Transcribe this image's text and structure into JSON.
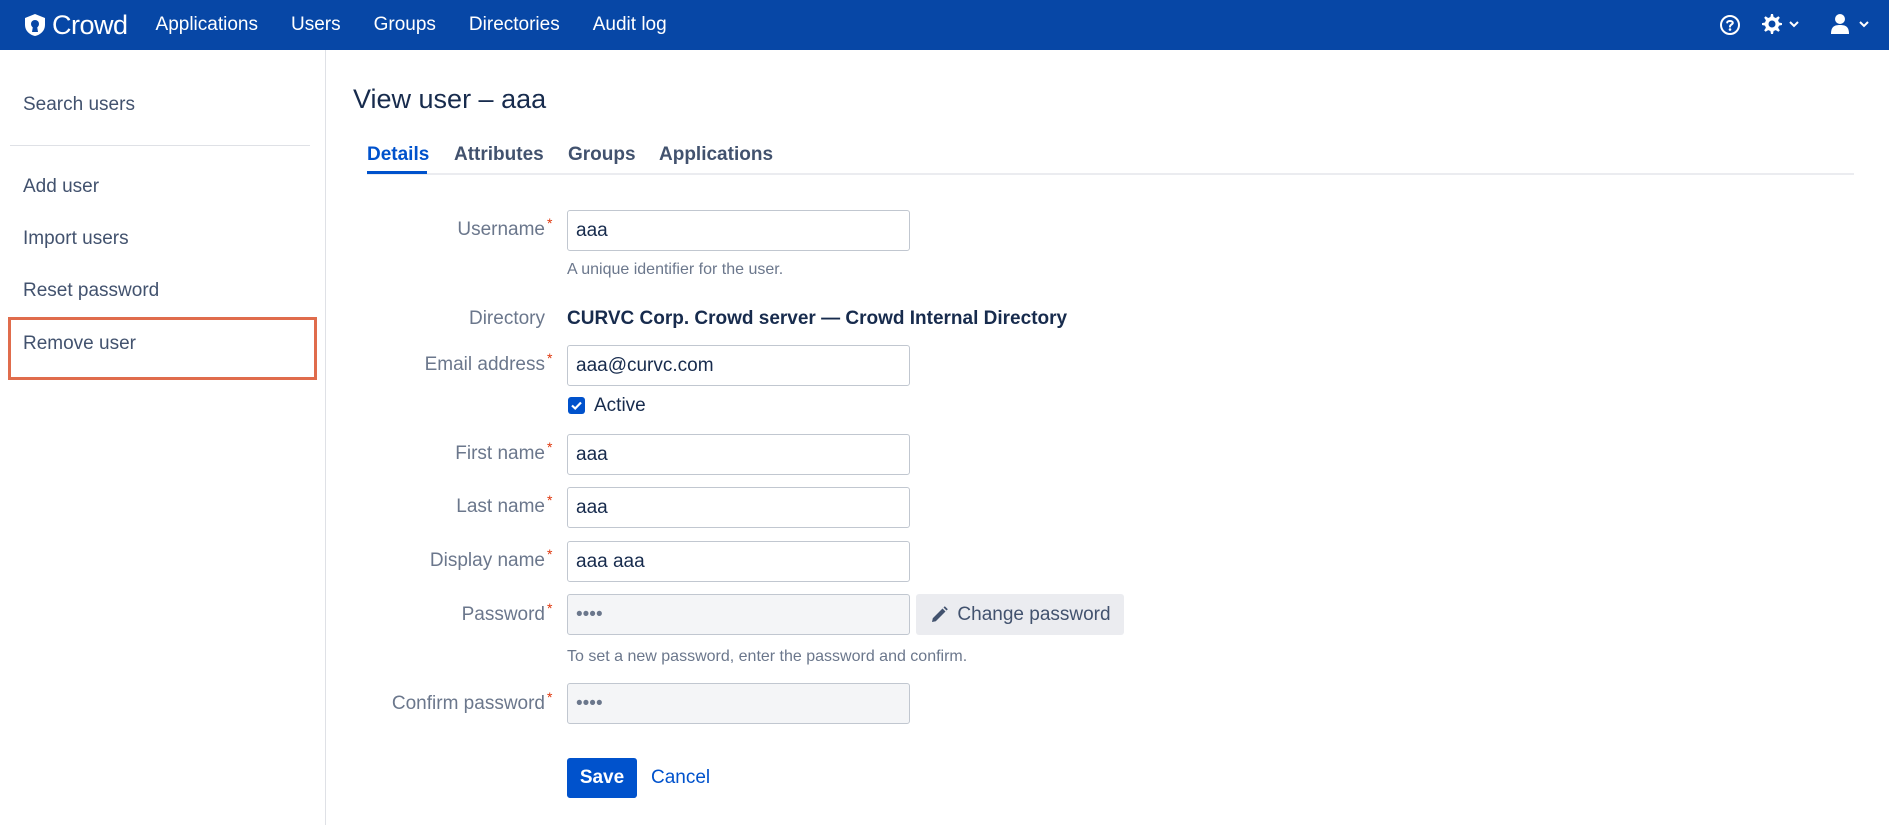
{
  "app": {
    "name": "Crowd"
  },
  "nav": {
    "items": [
      "Applications",
      "Users",
      "Groups",
      "Directories",
      "Audit log"
    ]
  },
  "topbar_icons": [
    "help-icon",
    "gear-icon",
    "user-icon"
  ],
  "sidebar": {
    "search": "Search users",
    "items": [
      "Add user",
      "Import users",
      "Reset password",
      "Remove user"
    ],
    "highlighted": "Remove user"
  },
  "page": {
    "title": "View user – aaa"
  },
  "tabs": [
    "Details",
    "Attributes",
    "Groups",
    "Applications"
  ],
  "active_tab": "Details",
  "form": {
    "username": {
      "label": "Username",
      "value": "aaa",
      "help": "A unique identifier for the user."
    },
    "directory": {
      "label": "Directory",
      "value": "CURVC Corp. Crowd server — Crowd Internal Directory"
    },
    "email": {
      "label": "Email address",
      "value": "aaa@curvc.com"
    },
    "active": {
      "label": "Active",
      "checked": true
    },
    "first_name": {
      "label": "First name",
      "value": "aaa"
    },
    "last_name": {
      "label": "Last name",
      "value": "aaa"
    },
    "display_name": {
      "label": "Display name",
      "value": "aaa aaa"
    },
    "password": {
      "label": "Password",
      "value": "••••",
      "help": "To set a new password, enter the password and confirm.",
      "change_label": "Change password"
    },
    "confirm_password": {
      "label": "Confirm password",
      "value": "••••"
    },
    "required_mark": "*"
  },
  "actions": {
    "save": "Save",
    "cancel": "Cancel"
  },
  "colors": {
    "topbar": "#0747a6",
    "primary": "#0052cc",
    "highlight_border": "#e06c4c",
    "required": "#de350b"
  }
}
